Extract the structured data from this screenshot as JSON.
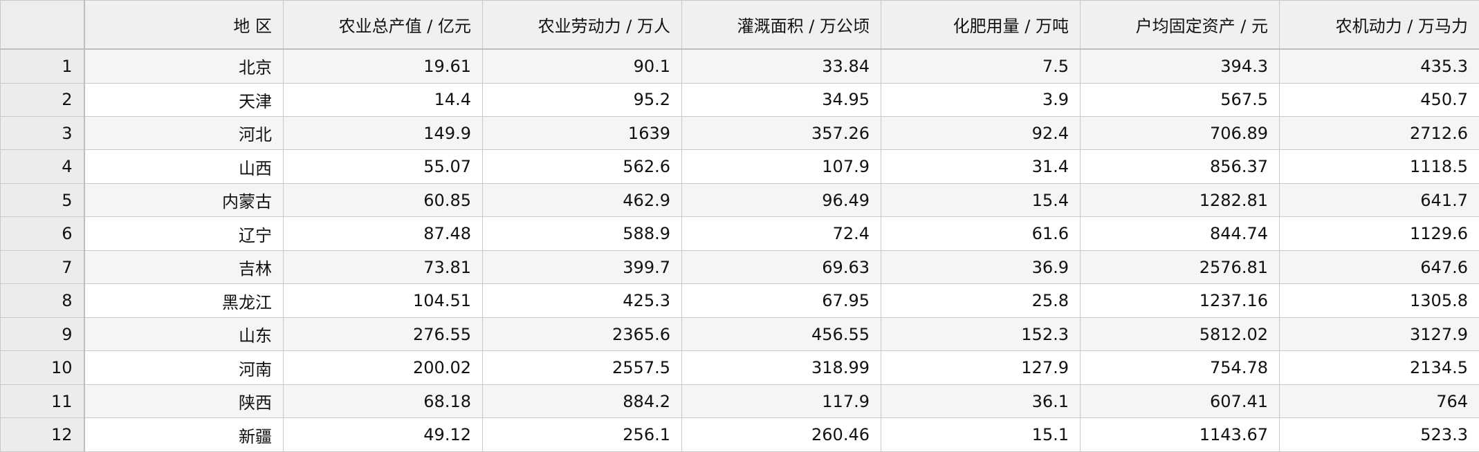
{
  "table": {
    "columns": [
      "地 区",
      "农业总产值 / 亿元",
      "农业劳动力 / 万人",
      "灌溉面积 / 万公顷",
      "化肥用量 / 万吨",
      "户均固定资产 / 元",
      "农机动力 / 万马力"
    ],
    "rows": [
      {
        "n": "1",
        "cells": [
          "北京",
          "19.61",
          "90.1",
          "33.84",
          "7.5",
          "394.3",
          "435.3"
        ]
      },
      {
        "n": "2",
        "cells": [
          "天津",
          "14.4",
          "95.2",
          "34.95",
          "3.9",
          "567.5",
          "450.7"
        ]
      },
      {
        "n": "3",
        "cells": [
          "河北",
          "149.9",
          "1639",
          "357.26",
          "92.4",
          "706.89",
          "2712.6"
        ]
      },
      {
        "n": "4",
        "cells": [
          "山西",
          "55.07",
          "562.6",
          "107.9",
          "31.4",
          "856.37",
          "1118.5"
        ]
      },
      {
        "n": "5",
        "cells": [
          "内蒙古",
          "60.85",
          "462.9",
          "96.49",
          "15.4",
          "1282.81",
          "641.7"
        ]
      },
      {
        "n": "6",
        "cells": [
          "辽宁",
          "87.48",
          "588.9",
          "72.4",
          "61.6",
          "844.74",
          "1129.6"
        ]
      },
      {
        "n": "7",
        "cells": [
          "吉林",
          "73.81",
          "399.7",
          "69.63",
          "36.9",
          "2576.81",
          "647.6"
        ]
      },
      {
        "n": "8",
        "cells": [
          "黑龙江",
          "104.51",
          "425.3",
          "67.95",
          "25.8",
          "1237.16",
          "1305.8"
        ]
      },
      {
        "n": "9",
        "cells": [
          "山东",
          "276.55",
          "2365.6",
          "456.55",
          "152.3",
          "5812.02",
          "3127.9"
        ]
      },
      {
        "n": "10",
        "cells": [
          "河南",
          "200.02",
          "2557.5",
          "318.99",
          "127.9",
          "754.78",
          "2134.5"
        ]
      },
      {
        "n": "11",
        "cells": [
          "陕西",
          "68.18",
          "884.2",
          "117.9",
          "36.1",
          "607.41",
          "764"
        ]
      },
      {
        "n": "12",
        "cells": [
          "新疆",
          "49.12",
          "256.1",
          "260.46",
          "15.1",
          "1143.67",
          "523.3"
        ]
      }
    ]
  }
}
